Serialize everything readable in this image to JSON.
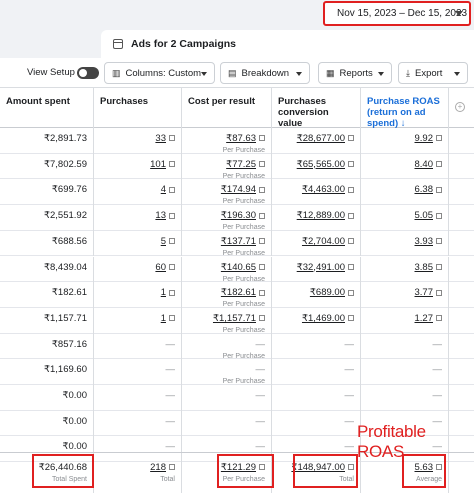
{
  "date_range": "Nov 15, 2023 – Dec 15, 2023",
  "tab_title": "Ads for 2 Campaigns",
  "toolbar": {
    "view_setup": "View Setup",
    "columns": "Columns: Custom",
    "breakdown": "Breakdown",
    "reports": "Reports",
    "export": "Export"
  },
  "headers": {
    "amount_spent": "Amount spent",
    "purchases": "Purchases",
    "cost_per_result": "Cost per result",
    "conversion_value": "Purchases conversion value",
    "roas": "Purchase ROAS (return on ad spend) ↓"
  },
  "rows": [
    {
      "spent": "₹2,891.73",
      "purchases": "33",
      "cpr": "₹87.63",
      "cpr_sub": "Per Purchase",
      "value": "₹28,677.00",
      "roas": "9.92"
    },
    {
      "spent": "₹7,802.59",
      "purchases": "101",
      "cpr": "₹77.25",
      "cpr_sub": "Per Purchase",
      "value": "₹65,565.00",
      "roas": "8.40"
    },
    {
      "spent": "₹699.76",
      "purchases": "4",
      "cpr": "₹174.94",
      "cpr_sub": "Per Purchase",
      "value": "₹4,463.00",
      "roas": "6.38"
    },
    {
      "spent": "₹2,551.92",
      "purchases": "13",
      "cpr": "₹196.30",
      "cpr_sub": "Per Purchase",
      "value": "₹12,889.00",
      "roas": "5.05"
    },
    {
      "spent": "₹688.56",
      "purchases": "5",
      "cpr": "₹137.71",
      "cpr_sub": "Per Purchase",
      "value": "₹2,704.00",
      "roas": "3.93"
    },
    {
      "spent": "₹8,439.04",
      "purchases": "60",
      "cpr": "₹140.65",
      "cpr_sub": "Per Purchase",
      "value": "₹32,491.00",
      "roas": "3.85"
    },
    {
      "spent": "₹182.61",
      "purchases": "1",
      "cpr": "₹182.61",
      "cpr_sub": "Per Purchase",
      "value": "₹689.00",
      "roas": "3.77"
    },
    {
      "spent": "₹1,157.71",
      "purchases": "1",
      "cpr": "₹1,157.71",
      "cpr_sub": "Per Purchase",
      "value": "₹1,469.00",
      "roas": "1.27"
    },
    {
      "spent": "₹857.16",
      "purchases": "—",
      "cpr": "—",
      "cpr_sub": "Per Purchase",
      "value": "—",
      "roas": "—"
    },
    {
      "spent": "₹1,169.60",
      "purchases": "—",
      "cpr": "—",
      "cpr_sub": "Per Purchase",
      "value": "—",
      "roas": "—"
    },
    {
      "spent": "₹0.00",
      "purchases": "—",
      "cpr": "—",
      "cpr_sub": "",
      "value": "—",
      "roas": "—"
    },
    {
      "spent": "₹0.00",
      "purchases": "—",
      "cpr": "—",
      "cpr_sub": "",
      "value": "—",
      "roas": "—"
    },
    {
      "spent": "₹0.00",
      "purchases": "—",
      "cpr": "—",
      "cpr_sub": "",
      "value": "—",
      "roas": "—"
    }
  ],
  "totals": {
    "spent": "₹26,440.68",
    "spent_sub": "Total Spent",
    "purchases": "218",
    "purchases_sub": "Total",
    "cpr": "₹121.29",
    "cpr_sub": "Per Purchase",
    "value": "₹148,947.00",
    "value_sub": "Total",
    "roas": "5.63",
    "roas_sub": "Average"
  },
  "annotation": "Profitable ROAS",
  "colors": {
    "highlight": "#e02020",
    "link_blue": "#1a6ed8"
  }
}
